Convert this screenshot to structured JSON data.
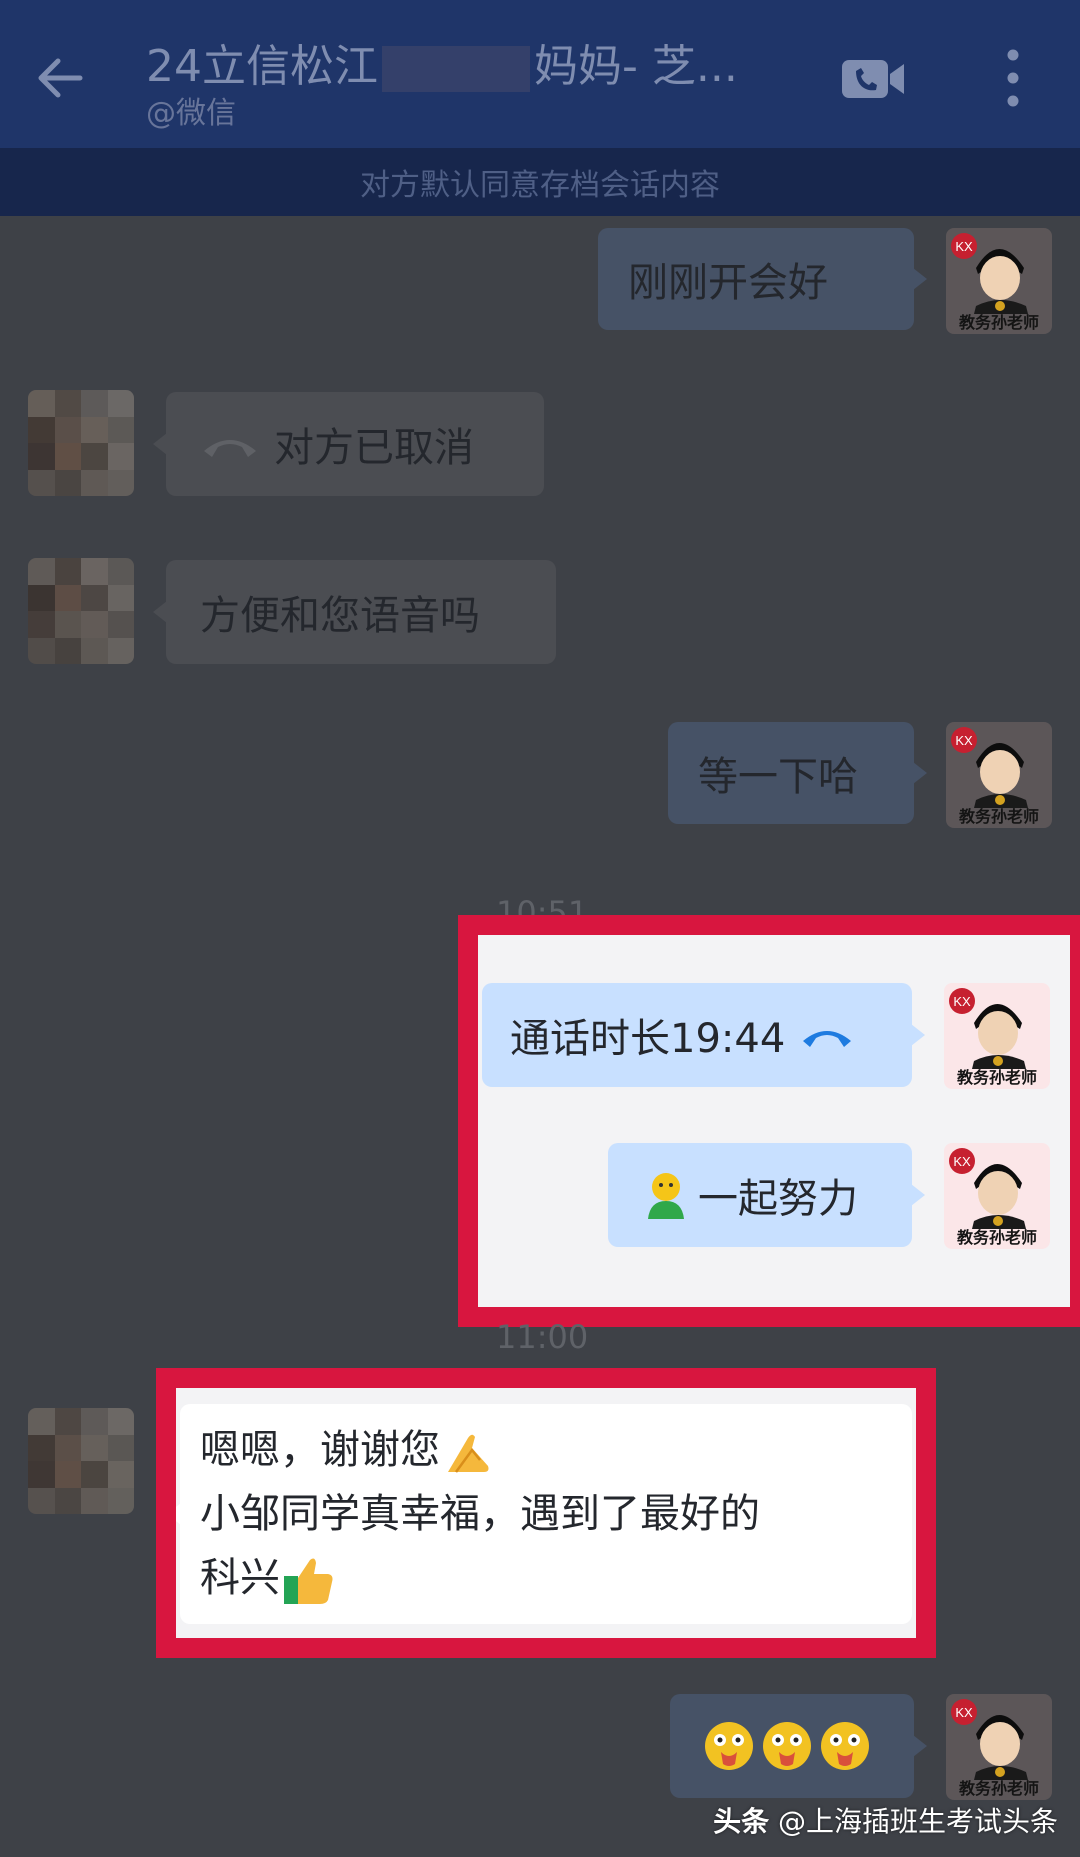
{
  "header": {
    "title_prefix": "24立信松江",
    "title_suffix": "妈妈- 芝...",
    "subtitle": "@微信",
    "back_icon": "arrow-left-icon",
    "video_icon": "video-call-icon",
    "more_icon": "more-vertical-icon"
  },
  "notice": "对方默认同意存档会话内容",
  "teacher_name": "教务孙老师",
  "messages": {
    "m1": "刚刚开会好",
    "m2": "对方已取消",
    "m3": "方便和您语音吗",
    "m4": "等一下哈",
    "m5": "通话时长19:44",
    "m6": "一起努力",
    "m7_line1": "嗯嗯，谢谢您",
    "m7_line2": "小邹同学真幸福，遇到了最好的",
    "m7_line3": "科兴"
  },
  "timestamps": {
    "t1": "10:51",
    "t2": "11:00"
  },
  "watermark": {
    "brand": "头条",
    "handle": "@上海插班生考试头条"
  },
  "colors": {
    "highlight_frame": "#d8163f",
    "header_bg": "#1f3569",
    "outgoing_bubble": "#c8e0ff",
    "call_icon_blue": "#1e7be0"
  }
}
